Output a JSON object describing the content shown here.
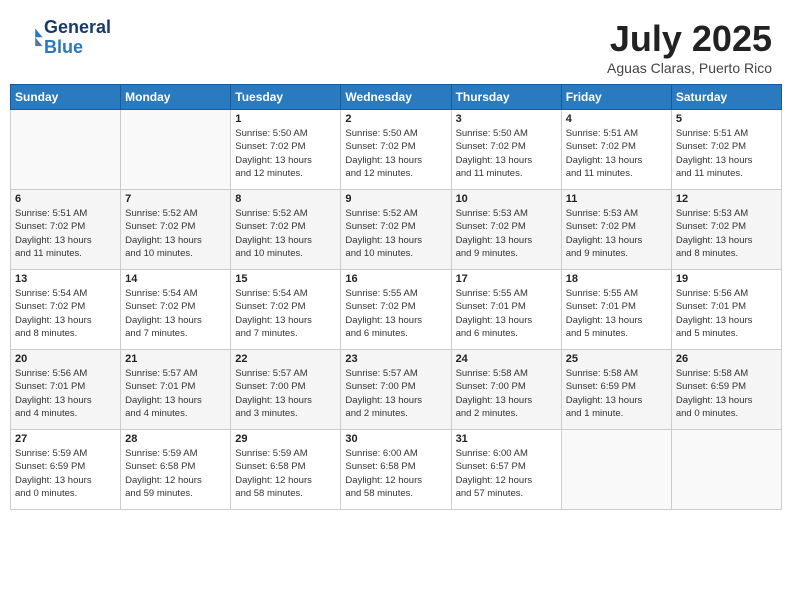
{
  "logo": {
    "line1": "General",
    "line2": "Blue"
  },
  "title": "July 2025",
  "location": "Aguas Claras, Puerto Rico",
  "days_header": [
    "Sunday",
    "Monday",
    "Tuesday",
    "Wednesday",
    "Thursday",
    "Friday",
    "Saturday"
  ],
  "weeks": [
    [
      {
        "day": "",
        "info": ""
      },
      {
        "day": "",
        "info": ""
      },
      {
        "day": "1",
        "info": "Sunrise: 5:50 AM\nSunset: 7:02 PM\nDaylight: 13 hours\nand 12 minutes."
      },
      {
        "day": "2",
        "info": "Sunrise: 5:50 AM\nSunset: 7:02 PM\nDaylight: 13 hours\nand 12 minutes."
      },
      {
        "day": "3",
        "info": "Sunrise: 5:50 AM\nSunset: 7:02 PM\nDaylight: 13 hours\nand 11 minutes."
      },
      {
        "day": "4",
        "info": "Sunrise: 5:51 AM\nSunset: 7:02 PM\nDaylight: 13 hours\nand 11 minutes."
      },
      {
        "day": "5",
        "info": "Sunrise: 5:51 AM\nSunset: 7:02 PM\nDaylight: 13 hours\nand 11 minutes."
      }
    ],
    [
      {
        "day": "6",
        "info": "Sunrise: 5:51 AM\nSunset: 7:02 PM\nDaylight: 13 hours\nand 11 minutes."
      },
      {
        "day": "7",
        "info": "Sunrise: 5:52 AM\nSunset: 7:02 PM\nDaylight: 13 hours\nand 10 minutes."
      },
      {
        "day": "8",
        "info": "Sunrise: 5:52 AM\nSunset: 7:02 PM\nDaylight: 13 hours\nand 10 minutes."
      },
      {
        "day": "9",
        "info": "Sunrise: 5:52 AM\nSunset: 7:02 PM\nDaylight: 13 hours\nand 10 minutes."
      },
      {
        "day": "10",
        "info": "Sunrise: 5:53 AM\nSunset: 7:02 PM\nDaylight: 13 hours\nand 9 minutes."
      },
      {
        "day": "11",
        "info": "Sunrise: 5:53 AM\nSunset: 7:02 PM\nDaylight: 13 hours\nand 9 minutes."
      },
      {
        "day": "12",
        "info": "Sunrise: 5:53 AM\nSunset: 7:02 PM\nDaylight: 13 hours\nand 8 minutes."
      }
    ],
    [
      {
        "day": "13",
        "info": "Sunrise: 5:54 AM\nSunset: 7:02 PM\nDaylight: 13 hours\nand 8 minutes."
      },
      {
        "day": "14",
        "info": "Sunrise: 5:54 AM\nSunset: 7:02 PM\nDaylight: 13 hours\nand 7 minutes."
      },
      {
        "day": "15",
        "info": "Sunrise: 5:54 AM\nSunset: 7:02 PM\nDaylight: 13 hours\nand 7 minutes."
      },
      {
        "day": "16",
        "info": "Sunrise: 5:55 AM\nSunset: 7:02 PM\nDaylight: 13 hours\nand 6 minutes."
      },
      {
        "day": "17",
        "info": "Sunrise: 5:55 AM\nSunset: 7:01 PM\nDaylight: 13 hours\nand 6 minutes."
      },
      {
        "day": "18",
        "info": "Sunrise: 5:55 AM\nSunset: 7:01 PM\nDaylight: 13 hours\nand 5 minutes."
      },
      {
        "day": "19",
        "info": "Sunrise: 5:56 AM\nSunset: 7:01 PM\nDaylight: 13 hours\nand 5 minutes."
      }
    ],
    [
      {
        "day": "20",
        "info": "Sunrise: 5:56 AM\nSunset: 7:01 PM\nDaylight: 13 hours\nand 4 minutes."
      },
      {
        "day": "21",
        "info": "Sunrise: 5:57 AM\nSunset: 7:01 PM\nDaylight: 13 hours\nand 4 minutes."
      },
      {
        "day": "22",
        "info": "Sunrise: 5:57 AM\nSunset: 7:00 PM\nDaylight: 13 hours\nand 3 minutes."
      },
      {
        "day": "23",
        "info": "Sunrise: 5:57 AM\nSunset: 7:00 PM\nDaylight: 13 hours\nand 2 minutes."
      },
      {
        "day": "24",
        "info": "Sunrise: 5:58 AM\nSunset: 7:00 PM\nDaylight: 13 hours\nand 2 minutes."
      },
      {
        "day": "25",
        "info": "Sunrise: 5:58 AM\nSunset: 6:59 PM\nDaylight: 13 hours\nand 1 minute."
      },
      {
        "day": "26",
        "info": "Sunrise: 5:58 AM\nSunset: 6:59 PM\nDaylight: 13 hours\nand 0 minutes."
      }
    ],
    [
      {
        "day": "27",
        "info": "Sunrise: 5:59 AM\nSunset: 6:59 PM\nDaylight: 13 hours\nand 0 minutes."
      },
      {
        "day": "28",
        "info": "Sunrise: 5:59 AM\nSunset: 6:58 PM\nDaylight: 12 hours\nand 59 minutes."
      },
      {
        "day": "29",
        "info": "Sunrise: 5:59 AM\nSunset: 6:58 PM\nDaylight: 12 hours\nand 58 minutes."
      },
      {
        "day": "30",
        "info": "Sunrise: 6:00 AM\nSunset: 6:58 PM\nDaylight: 12 hours\nand 58 minutes."
      },
      {
        "day": "31",
        "info": "Sunrise: 6:00 AM\nSunset: 6:57 PM\nDaylight: 12 hours\nand 57 minutes."
      },
      {
        "day": "",
        "info": ""
      },
      {
        "day": "",
        "info": ""
      }
    ]
  ]
}
